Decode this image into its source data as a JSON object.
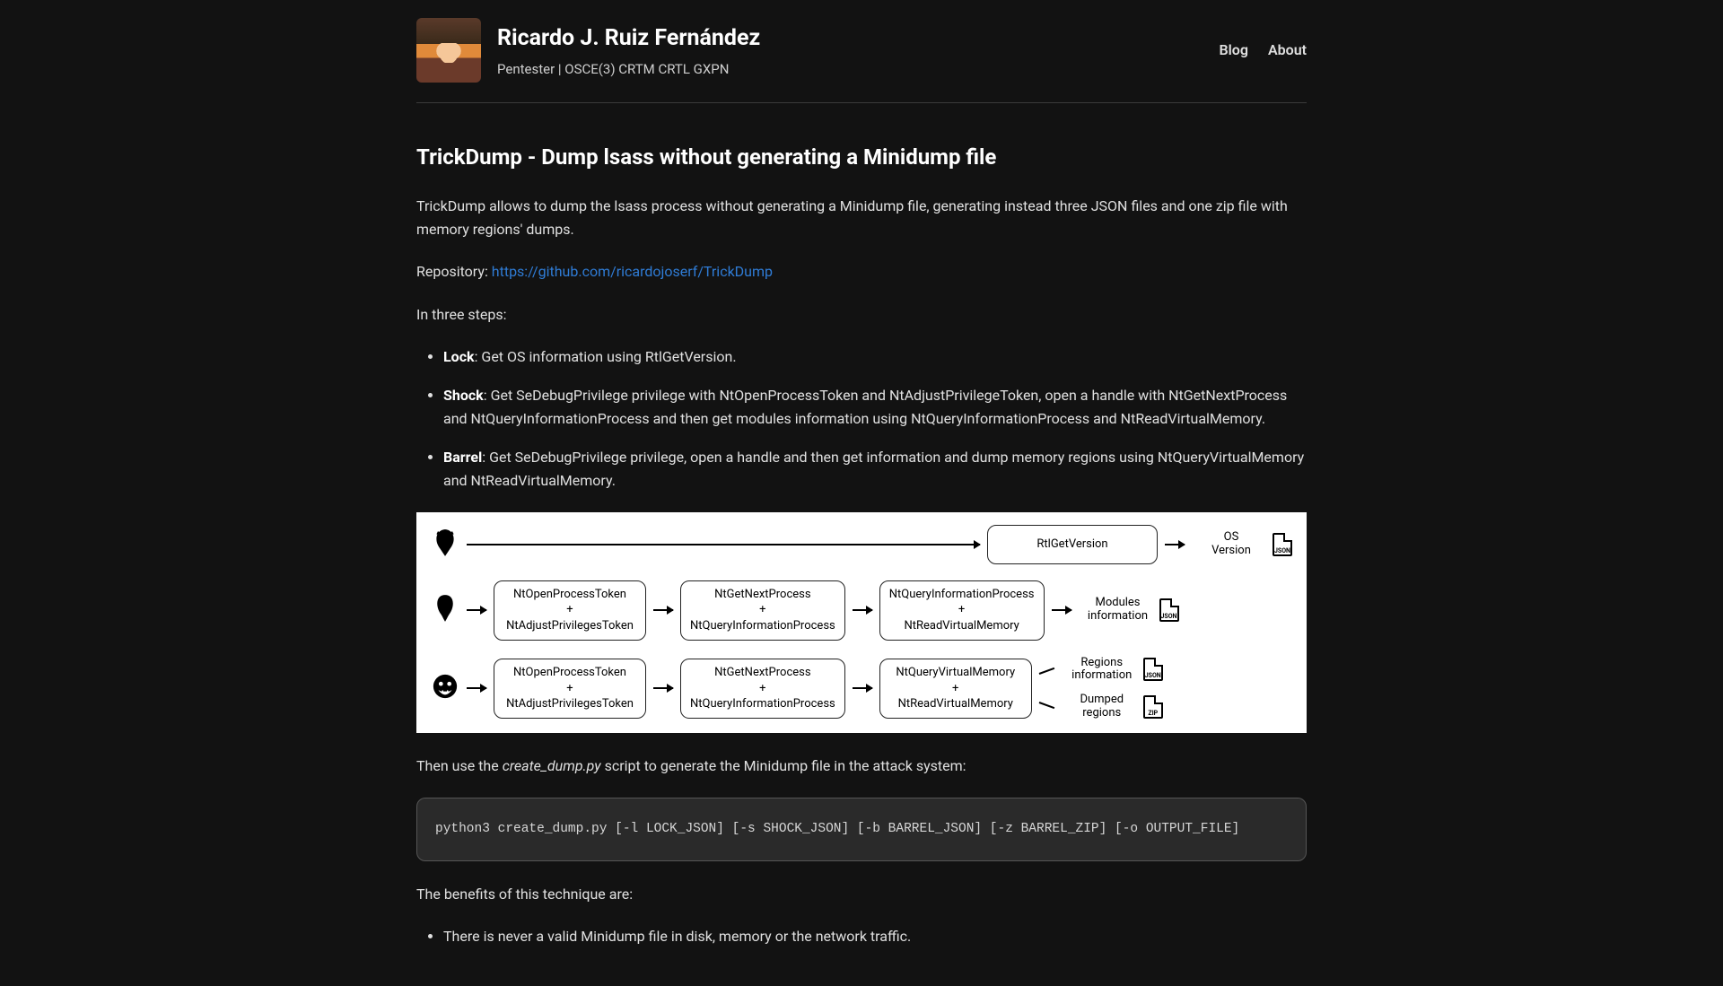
{
  "header": {
    "name": "Ricardo J. Ruiz Fernández",
    "subtitle": "Pentester | OSCE(3) CRTM CRTL GXPN",
    "nav": {
      "blog": "Blog",
      "about": "About"
    }
  },
  "article": {
    "title": "TrickDump - Dump lsass without generating a Minidump file",
    "intro": "TrickDump allows to dump the lsass process without generating a Minidump file, generating instead three JSON files and one zip file with memory regions' dumps.",
    "repo_label": "Repository: ",
    "repo_url": "https://github.com/ricardojoserf/TrickDump",
    "steps_intro": "In three steps:",
    "steps": [
      {
        "name": "Lock",
        "desc": ": Get OS information using RtlGetVersion."
      },
      {
        "name": "Shock",
        "desc": ": Get SeDebugPrivilege privilege with NtOpenProcessToken and NtAdjustPrivilegeToken, open a handle with NtGetNextProcess and NtQueryInformationProcess and then get modules information using NtQueryInformationProcess and NtReadVirtualMemory."
      },
      {
        "name": "Barrel",
        "desc": ": Get SeDebugPrivilege privilege, open a handle and then get information and dump memory regions using NtQueryVirtualMemory and NtReadVirtualMemory."
      }
    ],
    "diagram": {
      "rows": [
        {
          "icon": "mask-devil-icon",
          "boxes": [
            "RtlGetVersion"
          ],
          "outputs": [
            {
              "label_top": "OS",
              "label_bottom": "Version",
              "file": "JSON"
            }
          ]
        },
        {
          "icon": "mask-tribal-icon",
          "boxes": [
            "NtOpenProcessToken\n+\nNtAdjustPrivilegesToken",
            "NtGetNextProcess\n+\nNtQueryInformationProcess",
            "NtQueryInformationProcess\n+\nNtReadVirtualMemory"
          ],
          "outputs": [
            {
              "label_top": "Modules",
              "label_bottom": "information",
              "file": "JSON"
            }
          ]
        },
        {
          "icon": "mask-smile-icon",
          "boxes": [
            "NtOpenProcessToken\n+\nNtAdjustPrivilegesToken",
            "NtGetNextProcess\n+\nNtQueryInformationProcess",
            "NtQueryVirtualMemory\n+\nNtReadVirtualMemory"
          ],
          "outputs": [
            {
              "label_top": "Regions",
              "label_bottom": "information",
              "file": "JSON"
            },
            {
              "label_top": "Dumped",
              "label_bottom": "regions",
              "file": "ZIP"
            }
          ]
        }
      ]
    },
    "after_diagram_pre": "Then use the ",
    "after_diagram_script": "create_dump.py",
    "after_diagram_post": " script to generate the Minidump file in the attack system:",
    "code": "python3 create_dump.py [-l LOCK_JSON] [-s SHOCK_JSON] [-b BARREL_JSON] [-z BARREL_ZIP] [-o OUTPUT_FILE]",
    "benefits_intro": "The benefits of this technique are:",
    "benefits": [
      "There is never a valid Minidump file in disk, memory or the network traffic."
    ]
  }
}
